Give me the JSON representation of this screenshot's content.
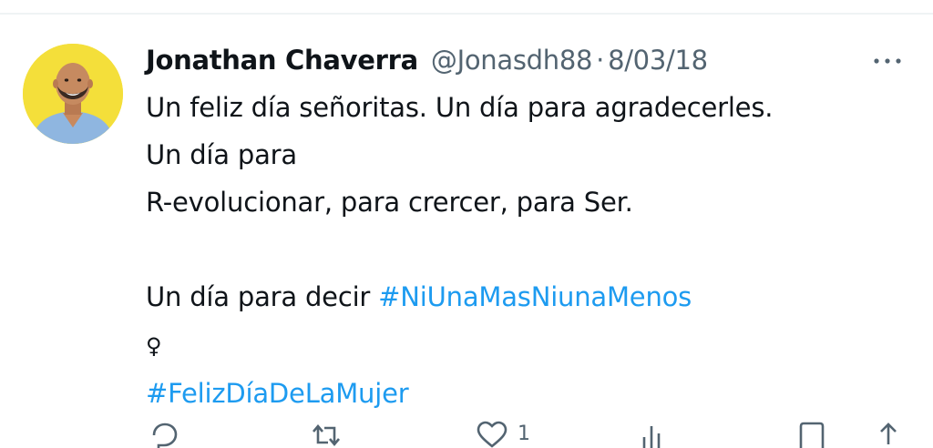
{
  "tweet": {
    "author": {
      "display_name": "Jonathan Chaverra",
      "handle": "@Jonasdh88"
    },
    "separator": "·",
    "date": "8/03/18",
    "more_label": "···",
    "text_lines": [
      "Un feliz día señoritas. Un día para agradecerles.",
      "Un día para",
      "R-evolucionar, para crercer, para Ser."
    ],
    "line_with_hashtag_prefix": "Un día para decir ",
    "hashtag_1": "#NiUnaMasNiunaMenos",
    "emoji": "♀",
    "hashtag_2": "#FelizDíaDeLaMujer",
    "actions": {
      "like_count": "1"
    }
  },
  "colors": {
    "text": "#0f1419",
    "secondary": "#536471",
    "link": "#1d9bf0",
    "avatar_bg": "#f4df3a"
  },
  "icons": [
    "more-icon",
    "reply-icon",
    "retweet-icon",
    "like-icon",
    "views-icon",
    "bookmark-icon",
    "share-icon"
  ]
}
